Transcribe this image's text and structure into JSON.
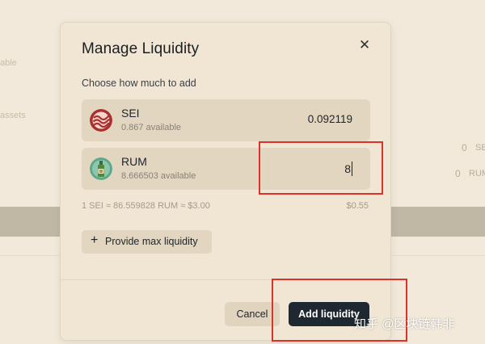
{
  "background": {
    "left_label_1": "able",
    "left_label_2": "assets",
    "right_row_1": {
      "value": "0",
      "unit": "SE"
    },
    "right_row_2": {
      "value": "0",
      "unit": "RUM"
    }
  },
  "modal": {
    "title": "Manage Liquidity",
    "close_icon": "close-icon",
    "subtitle": "Choose how much to add",
    "tokens": [
      {
        "symbol": "SEI",
        "available": "0.867 available",
        "amount": "0.092119",
        "icon": "sei-logo-icon",
        "color": "#a9302e"
      },
      {
        "symbol": "RUM",
        "available": "8.666503 available",
        "amount": "8",
        "icon": "rum-bottle-icon",
        "color": "#5ba98a"
      }
    ],
    "rate": "1 SEI ≈ 86.559828 RUM ≈ $3.00",
    "usd_total": "$0.55",
    "max_button": {
      "icon": "plus-icon",
      "label": "Provide max liquidity"
    },
    "cancel_label": "Cancel",
    "add_label": "Add liquidity"
  },
  "watermark": "知乎 @区块链韩非",
  "colors": {
    "accent_dark": "#1e2830",
    "annotation_red": "#e0302a",
    "modal_bg": "#f1e5d3",
    "row_bg": "#e2d6c1"
  }
}
